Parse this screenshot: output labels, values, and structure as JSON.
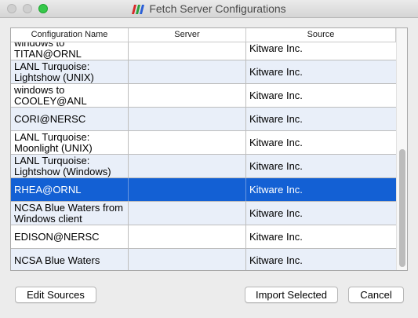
{
  "window": {
    "title": "Fetch Server Configurations"
  },
  "table": {
    "columns": [
      "Configuration Name",
      "Server",
      "Source"
    ],
    "rows": [
      {
        "name": "windows to TITAN@ORNL",
        "server": "",
        "source": "Kitware Inc."
      },
      {
        "name": "LANL Turquoise: Lightshow (UNIX)",
        "server": "",
        "source": "Kitware Inc."
      },
      {
        "name": "windows to COOLEY@ANL",
        "server": "",
        "source": "Kitware Inc."
      },
      {
        "name": "CORI@NERSC",
        "server": "",
        "source": "Kitware Inc."
      },
      {
        "name": "LANL Turquoise: Moonlight (UNIX)",
        "server": "",
        "source": "Kitware Inc."
      },
      {
        "name": "LANL Turquoise: Lightshow (Windows)",
        "server": "",
        "source": "Kitware Inc."
      },
      {
        "name": "RHEA@ORNL",
        "server": "",
        "source": "Kitware Inc.",
        "selected": true
      },
      {
        "name": "NCSA Blue Waters from Windows client",
        "server": "",
        "source": "Kitware Inc."
      },
      {
        "name": "EDISON@NERSC",
        "server": "",
        "source": "Kitware Inc."
      },
      {
        "name": "NCSA Blue Waters",
        "server": "",
        "source": "Kitware Inc."
      }
    ]
  },
  "buttons": {
    "edit_sources": "Edit Sources",
    "import_selected": "Import Selected",
    "cancel": "Cancel"
  },
  "icons": {
    "app": "paraview-icon",
    "close": "close-icon",
    "minimize": "minimize-icon",
    "maximize": "maximize-icon"
  },
  "colors": {
    "selection": "#1360d4",
    "alt_row": "#e9eff9",
    "maximize": "#36c84a"
  }
}
